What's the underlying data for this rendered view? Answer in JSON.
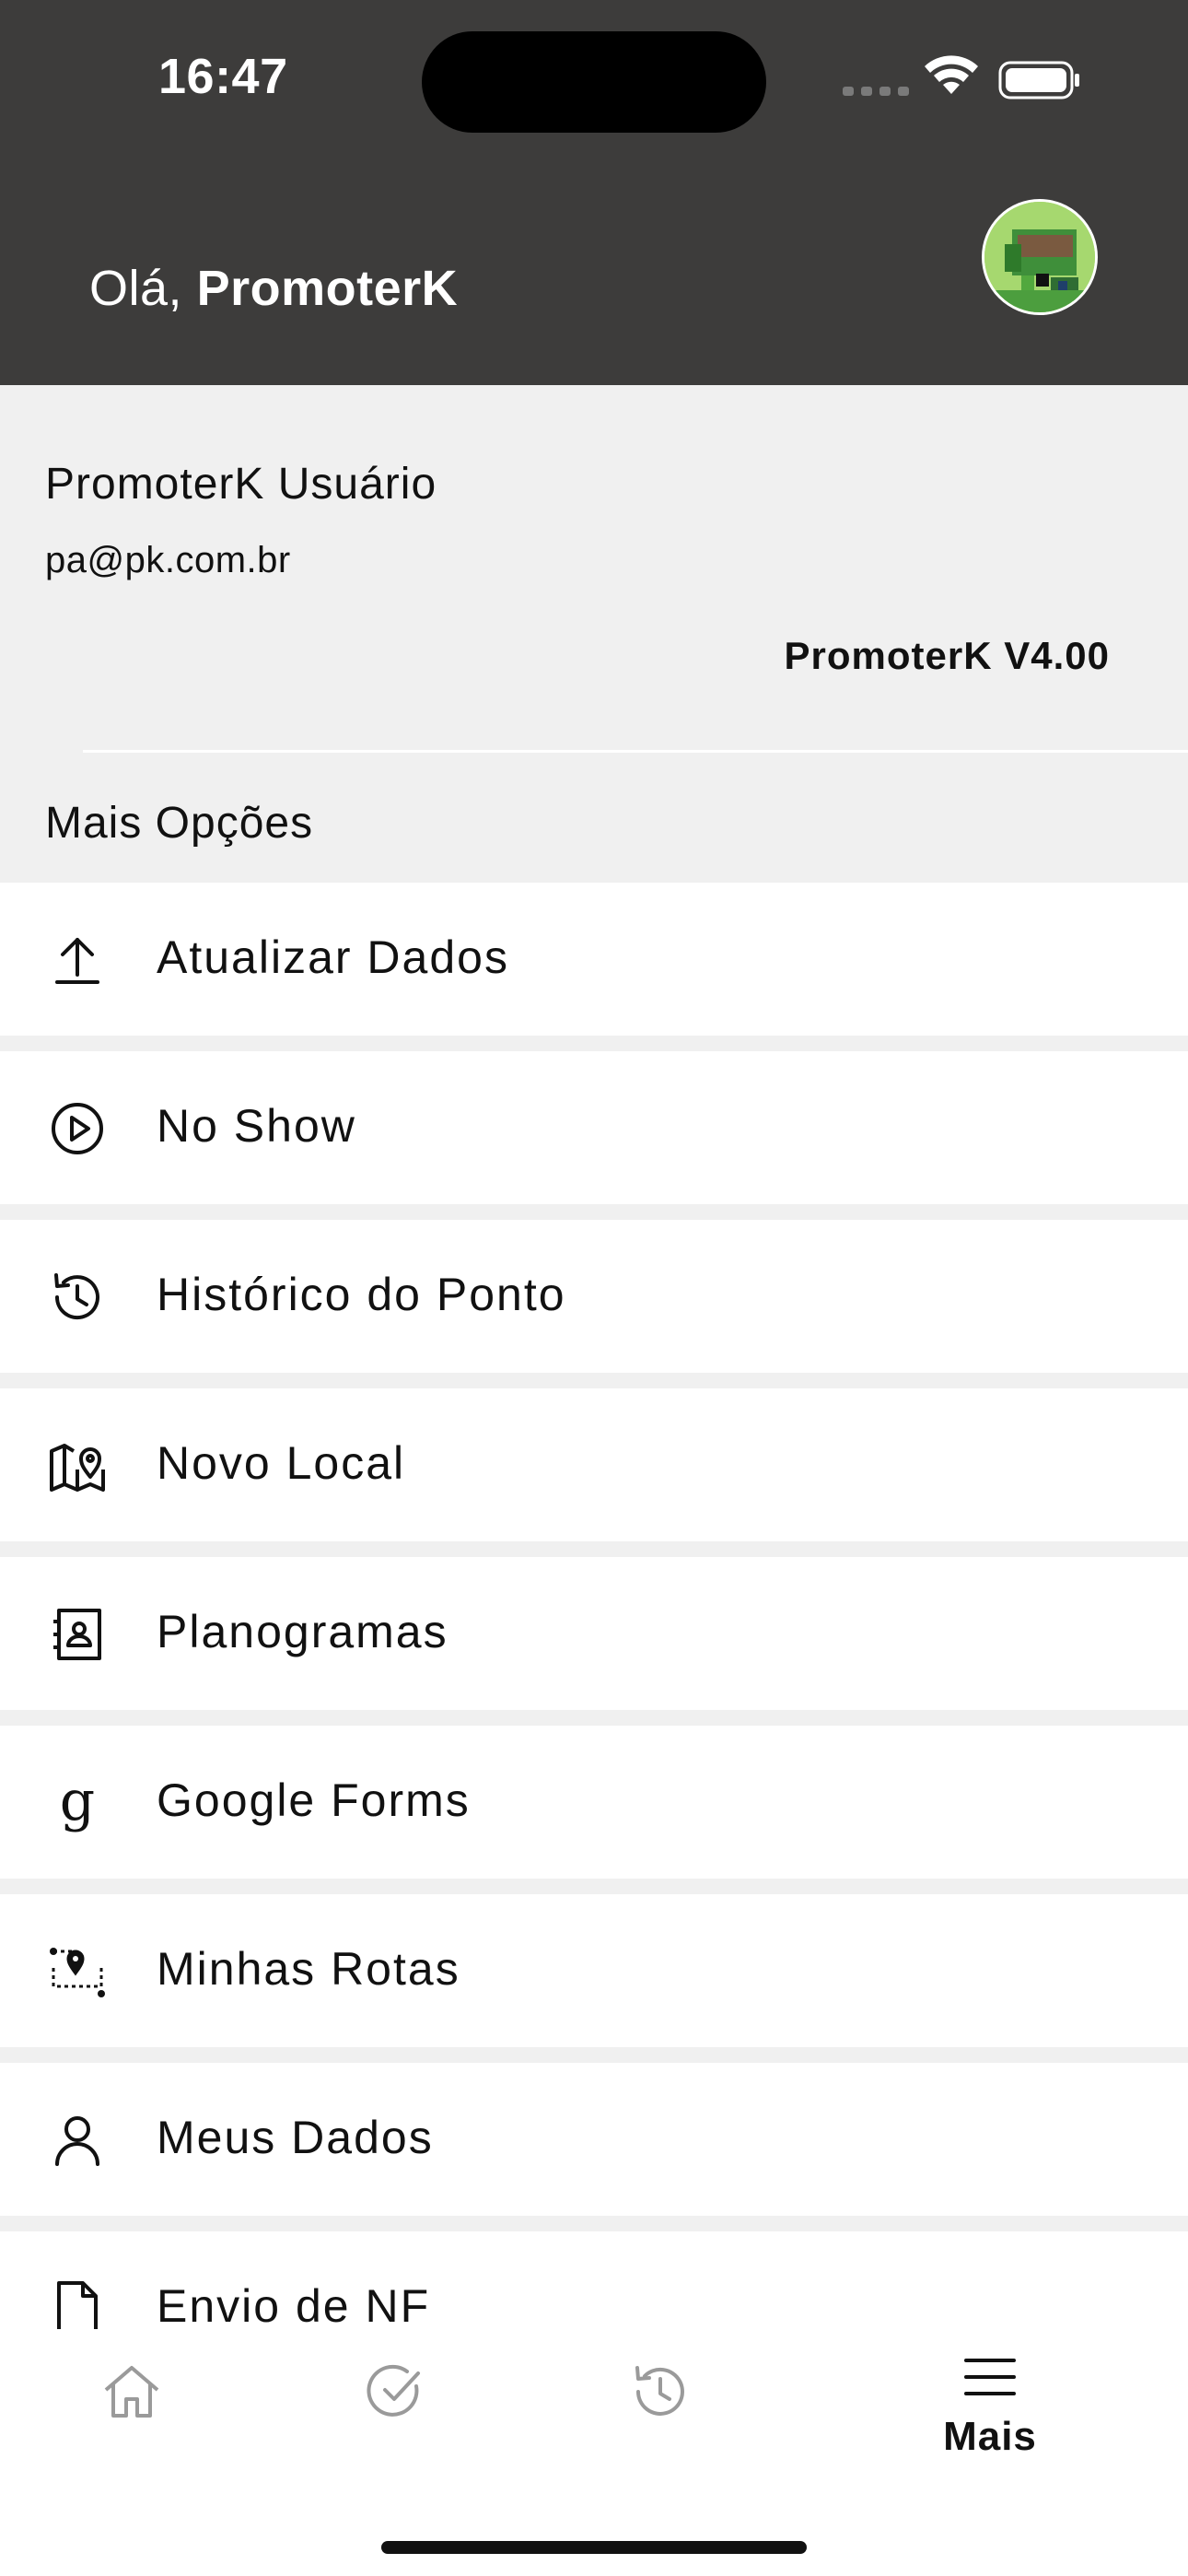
{
  "status_bar": {
    "time": "16:47"
  },
  "header": {
    "greeting_prefix": "Olá,",
    "greeting_name": "PromoterK"
  },
  "profile": {
    "name": "PromoterK Usuário",
    "email": "pa@pk.com.br",
    "version": "PromoterK V4.00"
  },
  "section": {
    "title": "Mais Opções"
  },
  "menu": {
    "items": [
      {
        "label": "Atualizar Dados",
        "icon": "upload-icon"
      },
      {
        "label": "No Show",
        "icon": "play-circle-icon"
      },
      {
        "label": "Histórico do Ponto",
        "icon": "history-icon"
      },
      {
        "label": "Novo Local",
        "icon": "map-pin-icon"
      },
      {
        "label": "Planogramas",
        "icon": "contact-book-icon"
      },
      {
        "label": "Google Forms",
        "icon": "google-g-icon"
      },
      {
        "label": "Minhas Rotas",
        "icon": "route-icon"
      },
      {
        "label": "Meus Dados",
        "icon": "user-icon"
      },
      {
        "label": "Envio de NF",
        "icon": "file-icon"
      }
    ]
  },
  "tabbar": {
    "tabs": [
      {
        "name": "home",
        "icon": "home-icon",
        "label": ""
      },
      {
        "name": "check",
        "icon": "check-circle-icon",
        "label": ""
      },
      {
        "name": "history",
        "icon": "history-icon",
        "label": ""
      },
      {
        "name": "more",
        "icon": "menu-icon",
        "label": "Mais",
        "active": true
      }
    ]
  },
  "colors": {
    "header_bg": "#3d3c3b",
    "panel_bg": "#f0f0f0",
    "text": "#111111",
    "tab_inactive": "#9a9a9a"
  }
}
